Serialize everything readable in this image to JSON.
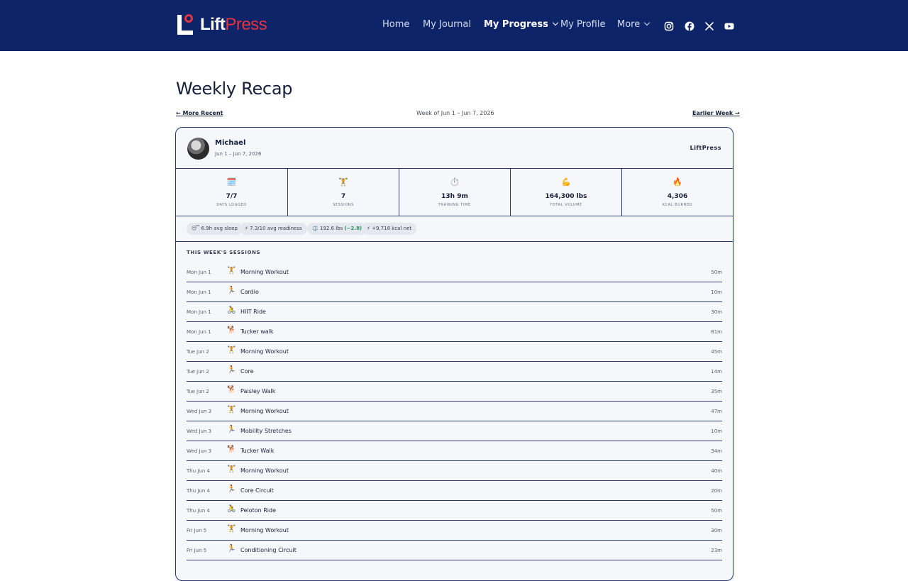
{
  "brand": {
    "name_part1": "Lift",
    "name_part2": "Press"
  },
  "nav": {
    "items": [
      {
        "label": "Home",
        "active": false
      },
      {
        "label": "My Journal",
        "active": false
      },
      {
        "label": "My Progress",
        "active": true,
        "dropdown": true
      },
      {
        "label": "My Profile",
        "active": false
      },
      {
        "label": "More",
        "active": false,
        "dropdown": true
      }
    ],
    "social": [
      "instagram-icon",
      "facebook-icon",
      "x-icon",
      "youtube-icon"
    ]
  },
  "page": {
    "title": "Weekly Recap",
    "pager": {
      "prev_label": "← More Recent",
      "week_label": "Week of Jun 1 – Jun 7, 2026",
      "next_label": "Earlier Week →"
    }
  },
  "card": {
    "user": {
      "name": "Michael",
      "range": "Jun 1 – Jun 7, 2026"
    },
    "brand_tag": "LiftPress",
    "stats": [
      {
        "icon": "🗓️",
        "icon_name": "calendar-icon",
        "value": "7/7",
        "label": "DAYS LOGGED"
      },
      {
        "icon": "🏋️",
        "icon_name": "weightlifter-icon",
        "value": "7",
        "label": "SESSIONS"
      },
      {
        "icon": "⏱️",
        "icon_name": "stopwatch-icon",
        "value": "13h 9m",
        "label": "TRAINING TIME"
      },
      {
        "icon": "💪",
        "icon_name": "flexed-biceps-icon",
        "value": "164,300 lbs",
        "label": "TOTAL VOLUME"
      },
      {
        "icon": "🔥",
        "icon_name": "fire-icon",
        "value": "4,306",
        "label": "KCAL BURNED"
      }
    ],
    "chips": [
      {
        "text": "😴 6.9h avg sleep"
      },
      {
        "text": "⚡ 7.3/10 avg readiness"
      },
      {
        "text": "⚖️ 192.6 lbs ",
        "delta": "(−2.8)"
      },
      {
        "text": "⚡ +9,718 kcal net"
      }
    ],
    "sessions_title": "THIS WEEK'S SESSIONS",
    "sessions": [
      {
        "day": "Mon Jun 1",
        "icon": "🏋️",
        "name": "Morning Workout",
        "duration": "50m"
      },
      {
        "day": "Mon Jun 1",
        "icon": "🏃",
        "name": "Cardio",
        "duration": "10m"
      },
      {
        "day": "Mon Jun 1",
        "icon": "🚴",
        "name": "HIIT Ride",
        "duration": "30m"
      },
      {
        "day": "Mon Jun 1",
        "icon": "🐕",
        "name": "Tucker walk",
        "duration": "81m"
      },
      {
        "day": "Tue Jun 2",
        "icon": "🏋️",
        "name": "Morning Workout",
        "duration": "45m"
      },
      {
        "day": "Tue Jun 2",
        "icon": "🏃",
        "name": "Core",
        "duration": "14m"
      },
      {
        "day": "Tue Jun 2",
        "icon": "🐕",
        "name": "Paisley Walk",
        "duration": "35m"
      },
      {
        "day": "Wed Jun 3",
        "icon": "🏋️",
        "name": "Morning Workout",
        "duration": "47m"
      },
      {
        "day": "Wed Jun 3",
        "icon": "🏃",
        "name": "Mobility Stretches",
        "duration": "10m"
      },
      {
        "day": "Wed Jun 3",
        "icon": "🐕",
        "name": "Tucker Walk",
        "duration": "34m"
      },
      {
        "day": "Thu Jun 4",
        "icon": "🏋️",
        "name": "Morning Workout",
        "duration": "40m"
      },
      {
        "day": "Thu Jun 4",
        "icon": "🏃",
        "name": "Core Circuit",
        "duration": "20m"
      },
      {
        "day": "Thu Jun 4",
        "icon": "🚴",
        "name": "Peloton Ride",
        "duration": "50m"
      },
      {
        "day": "Fri Jun 5",
        "icon": "🏋️",
        "name": "Morning Workout",
        "duration": "30m"
      },
      {
        "day": "Fri Jun 5",
        "icon": "🏃",
        "name": "Conditioning Circuit",
        "duration": "23m"
      }
    ]
  }
}
